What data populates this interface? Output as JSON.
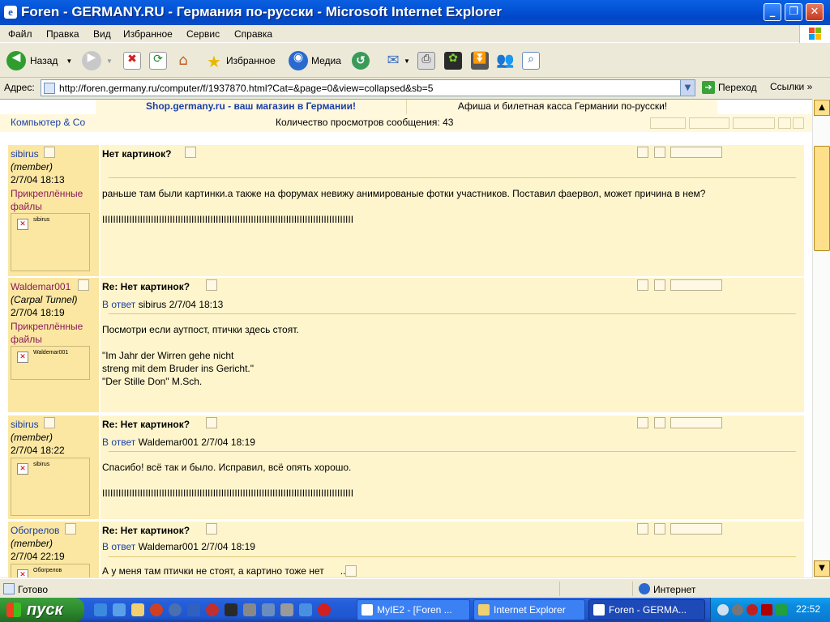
{
  "window": {
    "title": "Foren - GERMANY.RU - Германия по-русски - Microsoft Internet Explorer",
    "minimize": "_",
    "maximize": "❐",
    "close": "✕"
  },
  "menu": [
    "Файл",
    "Правка",
    "Вид",
    "Избранное",
    "Сервис",
    "Справка"
  ],
  "toolbar": {
    "back_label": "Назад",
    "favorites_label": "Избранное",
    "media_label": "Медиа"
  },
  "address": {
    "label": "Адрес:",
    "url": "http://foren.germany.ru/computer/f/1937870.html?Cat=&page=0&view=collapsed&sb=5",
    "go_label": "Переход",
    "links_label": "Ссылки"
  },
  "banner": {
    "left": "Shop.germany.ru - ваш магазин в Германии!",
    "right": "Афиша и билетная касса Германии по-русски!"
  },
  "forum": {
    "name": "Компьютер & Co",
    "views": "Количество просмотров сообщения: 43"
  },
  "posts": [
    {
      "user": "sibirus",
      "rank": "(member)",
      "date": "2/7/04 18:13",
      "attachments": "Прикреплённые файлы",
      "avatar": "sibirus",
      "title": "Нет картинок?",
      "reply_prefix": "",
      "reply_to": "",
      "body": "раньше там были картинки.а также на форумах невижу анимированые фотки участников. Поставил фаервол, может причина в нем?\n\nIIIIIIIIIIIIIIIIIIIIIIIIIIIIIIIIIIIIIIIIIIIIIIIIIIIIIIIIIIIIIIIIIIIIIIIIIIIIIIIIIIIIIIIIIIIII"
    },
    {
      "user": "Waldemar001",
      "rank": "(Carpal Tunnel)",
      "date": "2/7/04 18:19",
      "attachments": "Прикреплённые файлы",
      "avatar": "Waldemar001",
      "title": "Re: Нет картинок?",
      "reply_prefix": "В ответ",
      "reply_to": "sibirus 2/7/04 18:13",
      "body": "Посмотри если аутпост, птички здесь стоят.\n\n\"Im Jahr der Wirren gehe nicht\nstreng mit dem Bruder ins Gericht.\"\n\"Der Stille Don\" M.Sch."
    },
    {
      "user": "sibirus",
      "rank": "(member)",
      "date": "2/7/04 18:22",
      "attachments": "",
      "avatar": "sibirus",
      "title": "Re: Нет картинок?",
      "reply_prefix": "В ответ",
      "reply_to": "Waldemar001 2/7/04 18:19",
      "body": "Спасибо! всё так и было. Исправил, всё опять хорошо.\n\nIIIIIIIIIIIIIIIIIIIIIIIIIIIIIIIIIIIIIIIIIIIIIIIIIIIIIIIIIIIIIIIIIIIIIIIIIIIIIIIIIIIIIIIIIIIII"
    },
    {
      "user": "Обогрелов",
      "rank": "(member)",
      "date": "2/7/04 22:19",
      "attachments": "",
      "avatar": "Обогрелов",
      "title": "Re: Нет картинок?",
      "reply_prefix": "В ответ",
      "reply_to": "Waldemar001 2/7/04 18:19",
      "body": "А у меня там птички не стоят, а картино тоже нет      ..."
    }
  ],
  "status": {
    "text": "Готово",
    "zone": "Интернет"
  },
  "taskbar": {
    "start_label": "пуск",
    "tasks": [
      "MyIE2 - [Foren ...",
      "Internet Explorer",
      "Foren - GERMA..."
    ],
    "clock": "22:52"
  }
}
